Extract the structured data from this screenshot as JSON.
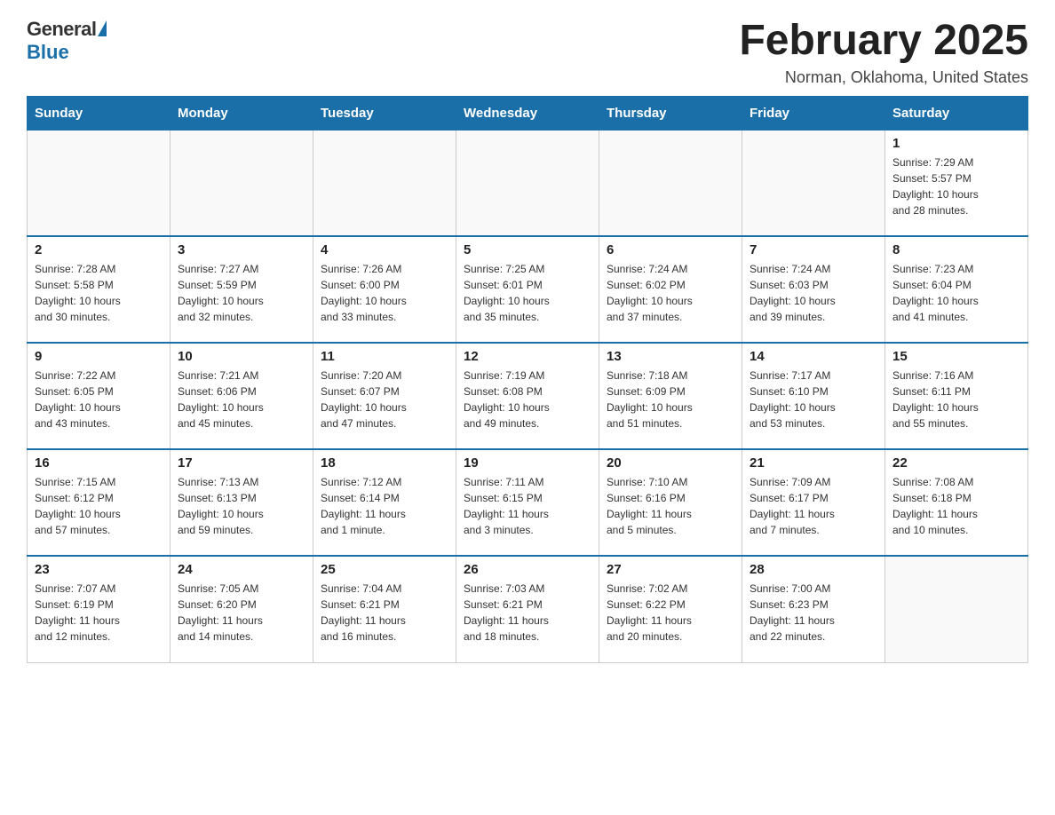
{
  "logo": {
    "general": "General",
    "blue": "Blue"
  },
  "title": "February 2025",
  "location": "Norman, Oklahoma, United States",
  "weekdays": [
    "Sunday",
    "Monday",
    "Tuesday",
    "Wednesday",
    "Thursday",
    "Friday",
    "Saturday"
  ],
  "weeks": [
    [
      {
        "day": "",
        "info": ""
      },
      {
        "day": "",
        "info": ""
      },
      {
        "day": "",
        "info": ""
      },
      {
        "day": "",
        "info": ""
      },
      {
        "day": "",
        "info": ""
      },
      {
        "day": "",
        "info": ""
      },
      {
        "day": "1",
        "info": "Sunrise: 7:29 AM\nSunset: 5:57 PM\nDaylight: 10 hours\nand 28 minutes."
      }
    ],
    [
      {
        "day": "2",
        "info": "Sunrise: 7:28 AM\nSunset: 5:58 PM\nDaylight: 10 hours\nand 30 minutes."
      },
      {
        "day": "3",
        "info": "Sunrise: 7:27 AM\nSunset: 5:59 PM\nDaylight: 10 hours\nand 32 minutes."
      },
      {
        "day": "4",
        "info": "Sunrise: 7:26 AM\nSunset: 6:00 PM\nDaylight: 10 hours\nand 33 minutes."
      },
      {
        "day": "5",
        "info": "Sunrise: 7:25 AM\nSunset: 6:01 PM\nDaylight: 10 hours\nand 35 minutes."
      },
      {
        "day": "6",
        "info": "Sunrise: 7:24 AM\nSunset: 6:02 PM\nDaylight: 10 hours\nand 37 minutes."
      },
      {
        "day": "7",
        "info": "Sunrise: 7:24 AM\nSunset: 6:03 PM\nDaylight: 10 hours\nand 39 minutes."
      },
      {
        "day": "8",
        "info": "Sunrise: 7:23 AM\nSunset: 6:04 PM\nDaylight: 10 hours\nand 41 minutes."
      }
    ],
    [
      {
        "day": "9",
        "info": "Sunrise: 7:22 AM\nSunset: 6:05 PM\nDaylight: 10 hours\nand 43 minutes."
      },
      {
        "day": "10",
        "info": "Sunrise: 7:21 AM\nSunset: 6:06 PM\nDaylight: 10 hours\nand 45 minutes."
      },
      {
        "day": "11",
        "info": "Sunrise: 7:20 AM\nSunset: 6:07 PM\nDaylight: 10 hours\nand 47 minutes."
      },
      {
        "day": "12",
        "info": "Sunrise: 7:19 AM\nSunset: 6:08 PM\nDaylight: 10 hours\nand 49 minutes."
      },
      {
        "day": "13",
        "info": "Sunrise: 7:18 AM\nSunset: 6:09 PM\nDaylight: 10 hours\nand 51 minutes."
      },
      {
        "day": "14",
        "info": "Sunrise: 7:17 AM\nSunset: 6:10 PM\nDaylight: 10 hours\nand 53 minutes."
      },
      {
        "day": "15",
        "info": "Sunrise: 7:16 AM\nSunset: 6:11 PM\nDaylight: 10 hours\nand 55 minutes."
      }
    ],
    [
      {
        "day": "16",
        "info": "Sunrise: 7:15 AM\nSunset: 6:12 PM\nDaylight: 10 hours\nand 57 minutes."
      },
      {
        "day": "17",
        "info": "Sunrise: 7:13 AM\nSunset: 6:13 PM\nDaylight: 10 hours\nand 59 minutes."
      },
      {
        "day": "18",
        "info": "Sunrise: 7:12 AM\nSunset: 6:14 PM\nDaylight: 11 hours\nand 1 minute."
      },
      {
        "day": "19",
        "info": "Sunrise: 7:11 AM\nSunset: 6:15 PM\nDaylight: 11 hours\nand 3 minutes."
      },
      {
        "day": "20",
        "info": "Sunrise: 7:10 AM\nSunset: 6:16 PM\nDaylight: 11 hours\nand 5 minutes."
      },
      {
        "day": "21",
        "info": "Sunrise: 7:09 AM\nSunset: 6:17 PM\nDaylight: 11 hours\nand 7 minutes."
      },
      {
        "day": "22",
        "info": "Sunrise: 7:08 AM\nSunset: 6:18 PM\nDaylight: 11 hours\nand 10 minutes."
      }
    ],
    [
      {
        "day": "23",
        "info": "Sunrise: 7:07 AM\nSunset: 6:19 PM\nDaylight: 11 hours\nand 12 minutes."
      },
      {
        "day": "24",
        "info": "Sunrise: 7:05 AM\nSunset: 6:20 PM\nDaylight: 11 hours\nand 14 minutes."
      },
      {
        "day": "25",
        "info": "Sunrise: 7:04 AM\nSunset: 6:21 PM\nDaylight: 11 hours\nand 16 minutes."
      },
      {
        "day": "26",
        "info": "Sunrise: 7:03 AM\nSunset: 6:21 PM\nDaylight: 11 hours\nand 18 minutes."
      },
      {
        "day": "27",
        "info": "Sunrise: 7:02 AM\nSunset: 6:22 PM\nDaylight: 11 hours\nand 20 minutes."
      },
      {
        "day": "28",
        "info": "Sunrise: 7:00 AM\nSunset: 6:23 PM\nDaylight: 11 hours\nand 22 minutes."
      },
      {
        "day": "",
        "info": ""
      }
    ]
  ]
}
